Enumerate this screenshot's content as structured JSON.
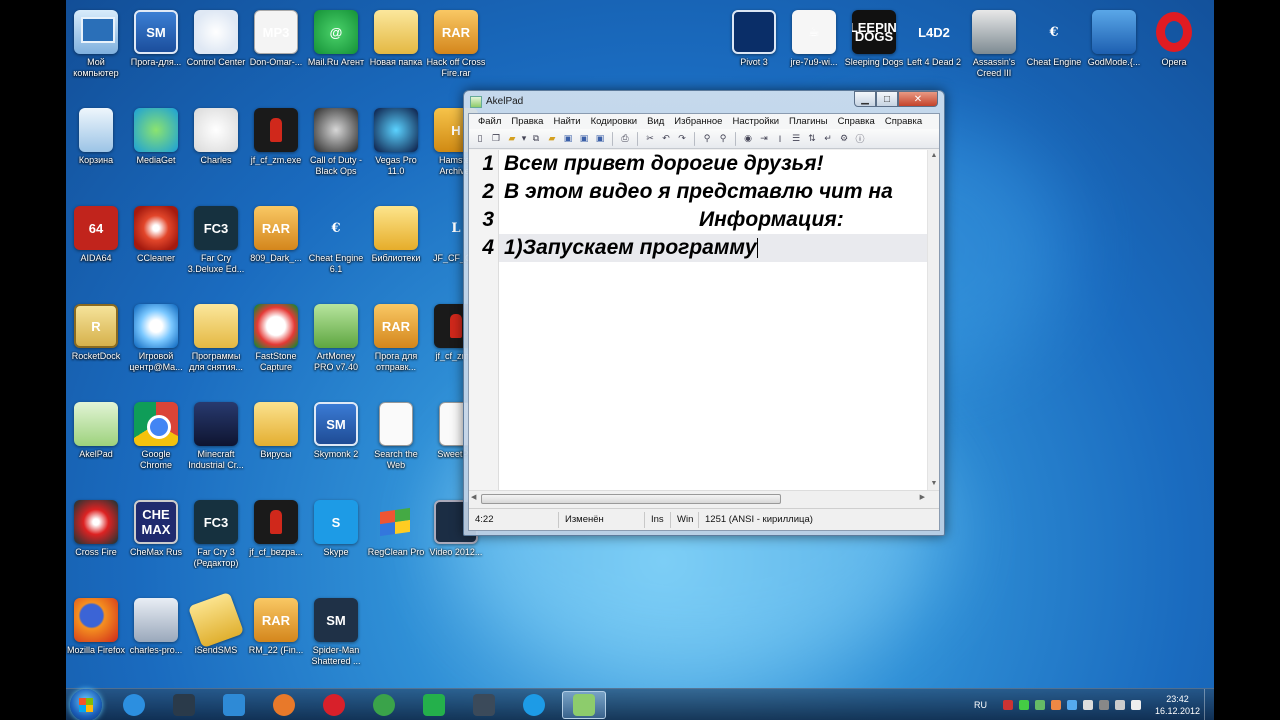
{
  "desktop": {
    "icons": [
      {
        "label": "Мой компьютер",
        "icon": "computer-icon",
        "cls": "i-pc",
        "col": 0,
        "row": 0
      },
      {
        "label": "Прога-для...",
        "icon": "skymonk-icon",
        "cls": "i-sm",
        "glyph": "SM",
        "col": 1,
        "row": 0
      },
      {
        "label": "Control Center",
        "icon": "windows-logo-icon",
        "cls": "i-win",
        "col": 2,
        "row": 0
      },
      {
        "label": "Don-Omar-...",
        "icon": "mp3-file-icon",
        "cls": "i-mp3",
        "glyph": "MP3",
        "col": 3,
        "row": 0
      },
      {
        "label": "Mail.Ru Агент",
        "icon": "mail-agent-icon",
        "cls": "i-at",
        "glyph": "@",
        "col": 4,
        "row": 0
      },
      {
        "label": "Новая папка",
        "icon": "folder-icon",
        "cls": "i-folder",
        "col": 5,
        "row": 0
      },
      {
        "label": "Hack off Cross Fire.rar",
        "icon": "rar-archive-icon",
        "cls": "i-rar",
        "glyph": "RAR",
        "col": 6,
        "row": 0
      },
      {
        "label": "Корзина",
        "icon": "recycle-bin-icon",
        "cls": "i-bin",
        "col": 0,
        "row": 1
      },
      {
        "label": "MediaGet",
        "icon": "mediaget-icon",
        "cls": "i-mg",
        "col": 1,
        "row": 1
      },
      {
        "label": "Charles",
        "icon": "jug-icon",
        "cls": "i-jug",
        "col": 2,
        "row": 1
      },
      {
        "label": "jf_cf_zm.exe",
        "icon": "exe-person-icon",
        "cls": "i-red",
        "col": 3,
        "row": 1
      },
      {
        "label": "Call of Duty - Black Ops",
        "icon": "skull-icon",
        "cls": "i-cod",
        "col": 4,
        "row": 1
      },
      {
        "label": "Vegas Pro 11.0",
        "icon": "vegas-icon",
        "cls": "i-vegas",
        "col": 5,
        "row": 1
      },
      {
        "label": "Hamster Archiver",
        "icon": "hamster-icon",
        "cls": "i-h",
        "glyph": "H",
        "col": 6,
        "row": 1
      },
      {
        "label": "AIDA64",
        "icon": "aida64-icon",
        "cls": "i-64",
        "glyph": "64",
        "col": 0,
        "row": 2
      },
      {
        "label": "CCleaner",
        "icon": "ccleaner-icon",
        "cls": "i-cc",
        "col": 1,
        "row": 2
      },
      {
        "label": "Far Cry 3.Deluxe Ed...",
        "icon": "farcry-icon",
        "cls": "i-fc3",
        "glyph": "FC3",
        "col": 2,
        "row": 2
      },
      {
        "label": "809_Dark_...",
        "icon": "rar-archive-icon",
        "cls": "i-rar",
        "glyph": "RAR",
        "col": 3,
        "row": 2
      },
      {
        "label": "Cheat Engine 6.1",
        "icon": "cheat-engine-icon",
        "cls": "i-ce",
        "glyph": "€",
        "col": 4,
        "row": 2
      },
      {
        "label": "Библиотеки",
        "icon": "libraries-folder-icon",
        "cls": "i-fold2",
        "col": 5,
        "row": 2
      },
      {
        "label": "JF_CF_C...",
        "icon": "letter-l-icon",
        "cls": "i-l",
        "glyph": "L",
        "col": 6,
        "row": 2
      },
      {
        "label": "RocketDock",
        "icon": "rocketdock-icon",
        "cls": "i-r",
        "glyph": "R",
        "col": 0,
        "row": 3
      },
      {
        "label": "Игровой центр@Ma...",
        "icon": "game-center-icon",
        "cls": "i-game",
        "col": 1,
        "row": 3
      },
      {
        "label": "Программы для снятия...",
        "icon": "folder-icon",
        "cls": "i-folder",
        "col": 2,
        "row": 3
      },
      {
        "label": "FastStone Capture",
        "icon": "faststone-icon",
        "cls": "i-fs",
        "col": 3,
        "row": 3
      },
      {
        "label": "ArtMoney PRO v7.40",
        "icon": "artmoney-icon",
        "cls": "i-money",
        "col": 4,
        "row": 3
      },
      {
        "label": "Прога для отправк...",
        "icon": "rar-archive-icon",
        "cls": "i-rar",
        "glyph": "RAR",
        "col": 5,
        "row": 3
      },
      {
        "label": "jf_cf_zm...",
        "icon": "exe-person-icon",
        "cls": "i-red",
        "col": 6,
        "row": 3
      },
      {
        "label": "AkelPad",
        "icon": "akelpad-icon",
        "cls": "i-akel",
        "col": 0,
        "row": 4
      },
      {
        "label": "Google Chrome",
        "icon": "chrome-icon",
        "cls": "i-chrome",
        "col": 1,
        "row": 4
      },
      {
        "label": "Minecraft Industrial Cr...",
        "icon": "minecraft-icon",
        "cls": "i-mine",
        "col": 2,
        "row": 4
      },
      {
        "label": "Вирусы",
        "icon": "folder-icon",
        "cls": "i-virus",
        "col": 3,
        "row": 4
      },
      {
        "label": "Skymonk 2",
        "icon": "skymonk-icon",
        "cls": "i-sky2",
        "glyph": "SM",
        "col": 4,
        "row": 4
      },
      {
        "label": "Search the Web",
        "icon": "blank-page-icon",
        "cls": "i-page",
        "col": 5,
        "row": 4
      },
      {
        "label": "SweetP...",
        "icon": "blank-page-icon",
        "cls": "i-page",
        "col": 6,
        "row": 4
      },
      {
        "label": "Cross Fire",
        "icon": "crossfire-icon",
        "cls": "i-cf",
        "col": 0,
        "row": 5
      },
      {
        "label": "CheMax Rus",
        "icon": "chemax-icon",
        "cls": "i-che",
        "glyph": "CHE MAX",
        "col": 1,
        "row": 5
      },
      {
        "label": "Far Cry 3 (Редактор)",
        "icon": "farcry-icon",
        "cls": "i-fc3",
        "glyph": "FC3",
        "col": 2,
        "row": 5
      },
      {
        "label": "jf_cf_bezpa...",
        "icon": "exe-person-icon",
        "cls": "i-red",
        "col": 3,
        "row": 5
      },
      {
        "label": "Skype",
        "icon": "skype-icon",
        "cls": "i-skype",
        "glyph": "S",
        "col": 4,
        "row": 5
      },
      {
        "label": "RegClean Pro",
        "icon": "regclean-flag-icon",
        "cls": "i-flag",
        "col": 5,
        "row": 5
      },
      {
        "label": "Video 2012...",
        "icon": "video-file-icon",
        "cls": "i-video",
        "col": 6,
        "row": 5
      },
      {
        "label": "Mozilla Firefox",
        "icon": "firefox-icon",
        "cls": "i-ff",
        "col": 0,
        "row": 6
      },
      {
        "label": "charles-pro...",
        "icon": "computer-tool-icon",
        "cls": "i-chars",
        "col": 1,
        "row": 6
      },
      {
        "label": "iSendSMS",
        "icon": "isendsms-icon",
        "cls": "i-isend",
        "col": 2,
        "row": 6
      },
      {
        "label": "RM_22 (Fin...",
        "icon": "rar-archive-icon",
        "cls": "i-rar",
        "glyph": "RAR",
        "col": 3,
        "row": 6
      },
      {
        "label": "Spider-Man Shattered ...",
        "icon": "spiderman-icon",
        "cls": "i-smx",
        "glyph": "SM",
        "col": 4,
        "row": 6
      }
    ],
    "right_icons": [
      {
        "label": "Pivot 3",
        "icon": "pivot-icon",
        "cls": "i-pivot"
      },
      {
        "label": "jre-7u9-wi...",
        "icon": "java-icon",
        "cls": "i-java",
        "glyph": "☕"
      },
      {
        "label": "Sleeping Dogs",
        "icon": "sleeping-dogs-icon",
        "cls": "i-sleep",
        "glyph": "SLEEPING DOGS"
      },
      {
        "label": "Left 4 Dead 2",
        "icon": "left4dead-icon",
        "cls": "i-l4d",
        "glyph": "L4D2"
      },
      {
        "label": "Assassin's Creed III",
        "icon": "assassins-creed-icon",
        "cls": "i-ac"
      },
      {
        "label": "Cheat Engine",
        "icon": "cheat-engine-icon",
        "cls": "i-ce",
        "glyph": "€"
      },
      {
        "label": "GodMode.{...",
        "icon": "control-panel-icon",
        "cls": "i-god"
      },
      {
        "label": "Opera",
        "icon": "opera-icon",
        "cls": "i-opera"
      }
    ]
  },
  "window": {
    "title": "AkelPad",
    "menu": [
      "Файл",
      "Правка",
      "Найти",
      "Кодировки",
      "Вид",
      "Избранное",
      "Настройки",
      "Плагины",
      "Справка",
      "Справка"
    ],
    "lines": [
      {
        "num": "1",
        "text": "Всем привет дорогие друзья!"
      },
      {
        "num": "2",
        "text": "В этом видео я представлю чит на"
      },
      {
        "num": "3",
        "text": "Информация:"
      },
      {
        "num": "4",
        "text": "1)Запускаем программу"
      }
    ],
    "status": {
      "position": "4:22",
      "modified": "Изменён",
      "ins": "Ins",
      "newline": "Win",
      "encoding": "1251  (ANSI - кириллица)"
    }
  },
  "taskbar": {
    "items": [
      {
        "icon": "internet-explorer-icon",
        "color": "#2c8fe0"
      },
      {
        "icon": "explorer-folder-icon",
        "color": "#2a3a4a"
      },
      {
        "icon": "mail-agent-icon",
        "color": "#2e8ad6"
      },
      {
        "icon": "firefox-icon",
        "color": "#e8792a"
      },
      {
        "icon": "opera-icon",
        "color": "#d8202a"
      },
      {
        "icon": "chrome-icon",
        "color": "#3aa34a"
      },
      {
        "icon": "mail-agent-icon",
        "color": "#24b04b"
      },
      {
        "icon": "cheat-engine-icon",
        "color": "#3b4a5a"
      },
      {
        "icon": "skype-icon",
        "color": "#1d9be6"
      },
      {
        "icon": "akelpad-icon",
        "color": "#8dcc6c"
      }
    ],
    "lang": "RU",
    "time": "23:42",
    "date": "16.12.2012"
  }
}
